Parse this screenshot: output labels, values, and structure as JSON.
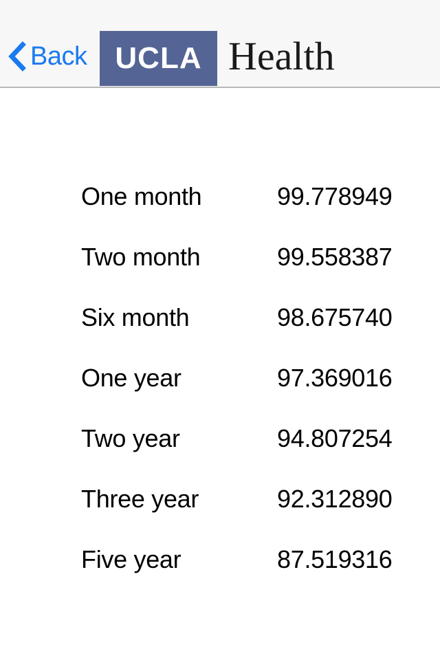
{
  "nav": {
    "back_label": "Back",
    "back_icon": "chevron-left-icon",
    "accent_color": "#1a7af0"
  },
  "brand": {
    "badge_text": "UCLA",
    "badge_color": "#546494",
    "wordmark": "Health"
  },
  "table": {
    "rows": [
      {
        "label": "One month",
        "value": "99.778949"
      },
      {
        "label": "Two month",
        "value": "99.558387"
      },
      {
        "label": "Six month",
        "value": "98.675740"
      },
      {
        "label": "One year",
        "value": "97.369016"
      },
      {
        "label": "Two year",
        "value": "94.807254"
      },
      {
        "label": "Three year",
        "value": "92.312890"
      },
      {
        "label": "Five year",
        "value": "87.519316"
      }
    ]
  }
}
